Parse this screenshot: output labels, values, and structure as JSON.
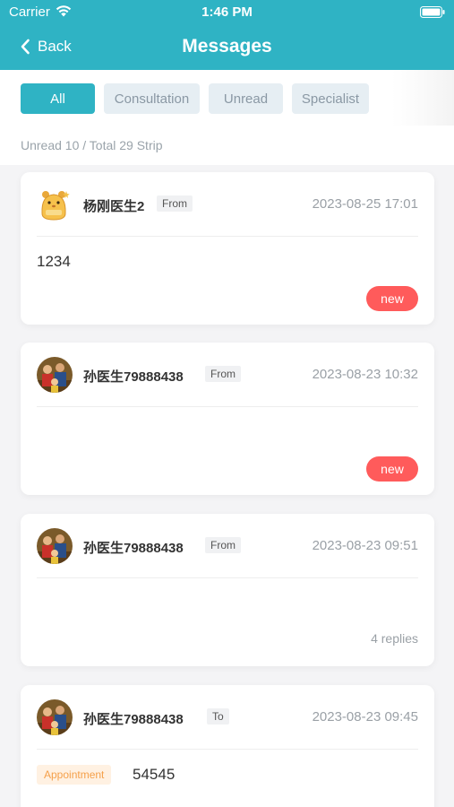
{
  "status_bar": {
    "carrier": "Carrier",
    "time": "1:46 PM"
  },
  "nav": {
    "back_label": "Back",
    "title": "Messages"
  },
  "filters": {
    "all": "All",
    "consultation": "Consultation",
    "unread": "Unread",
    "specialist": "Specialist",
    "active": "All"
  },
  "summary": "Unread 10 / Total 29 Strip",
  "colors": {
    "accent": "#2fb3c4",
    "new_badge": "#ff5b5b",
    "appointment": "#f5a04a"
  },
  "messages": [
    {
      "sender": "杨刚医生2",
      "direction": "From",
      "datetime": "2023-08-25 17:01",
      "body": "1234",
      "status": "new",
      "avatar": "hamster-avatar-icon"
    },
    {
      "sender": "孙医生79888438",
      "direction": "From",
      "datetime": "2023-08-23 10:32",
      "body": "",
      "status": "new",
      "avatar": "group-photo-avatar-icon"
    },
    {
      "sender": "孙医生79888438",
      "direction": "From",
      "datetime": "2023-08-23 09:51",
      "body": "",
      "status": "4 replies",
      "avatar": "group-photo-avatar-icon"
    },
    {
      "sender": "孙医生79888438",
      "direction": "To",
      "datetime": "2023-08-23 09:45",
      "tag": "Appointment",
      "body": "54545",
      "avatar": "group-photo-avatar-icon"
    }
  ]
}
